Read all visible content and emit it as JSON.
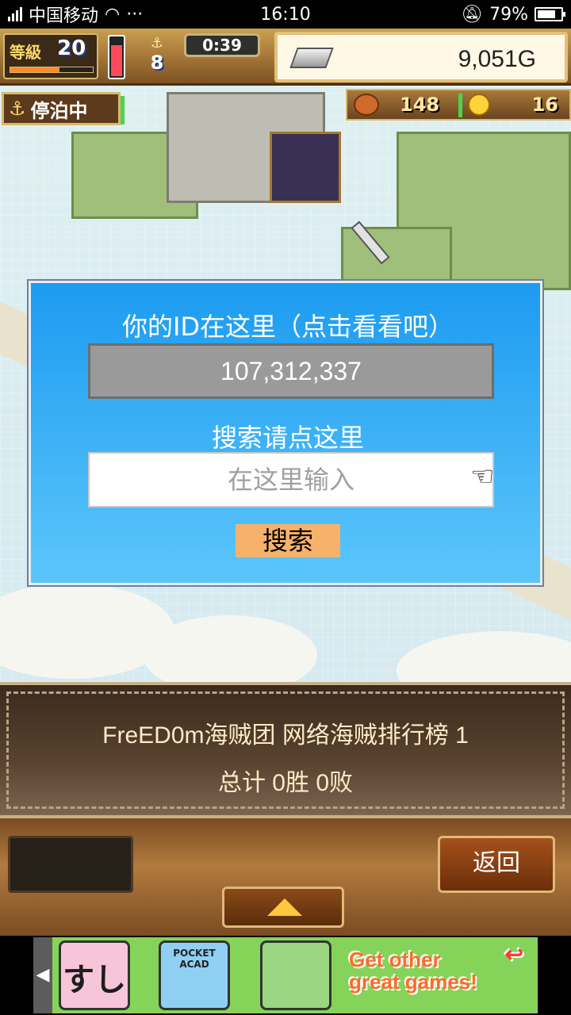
{
  "status_bar": {
    "carrier": "中国移动",
    "time": "16:10",
    "battery": "79%",
    "battery_level": 0.79,
    "icons": [
      "signal-icon",
      "wifi-icon",
      "more-icon",
      "mute-icon",
      "battery-icon"
    ]
  },
  "hud": {
    "level_label": "等級",
    "level": "20",
    "level_exp_fraction": 0.6,
    "energy_fraction": 0.75,
    "crew_count": "8",
    "timer": "0:39",
    "money": "9,051G"
  },
  "docked_label": "停泊中",
  "resources": {
    "food": "148",
    "coins": "16"
  },
  "dialog": {
    "title": "你的ID在这里（点击看看吧）",
    "id_value": "107,312,337",
    "search_label": "搜索请点这里",
    "input_placeholder": "在这里输入",
    "search_button": "搜索"
  },
  "info_panel": {
    "line1": "FreED0m海贼团  网络海贼排行榜  1",
    "line2": "总计 0胜 0败"
  },
  "controls": {
    "back_button": "返回"
  },
  "ad": {
    "app1_text": "すし",
    "app2_text": "POCKET ACAD",
    "cta_line1": "Get other",
    "cta_line2": "great games!"
  },
  "colors": {
    "dialog_top": "#1c9bf0",
    "dialog_bottom": "#5cc6fb",
    "search_button_bg": "#f6b26b",
    "info_text": "#ffe9c8"
  }
}
